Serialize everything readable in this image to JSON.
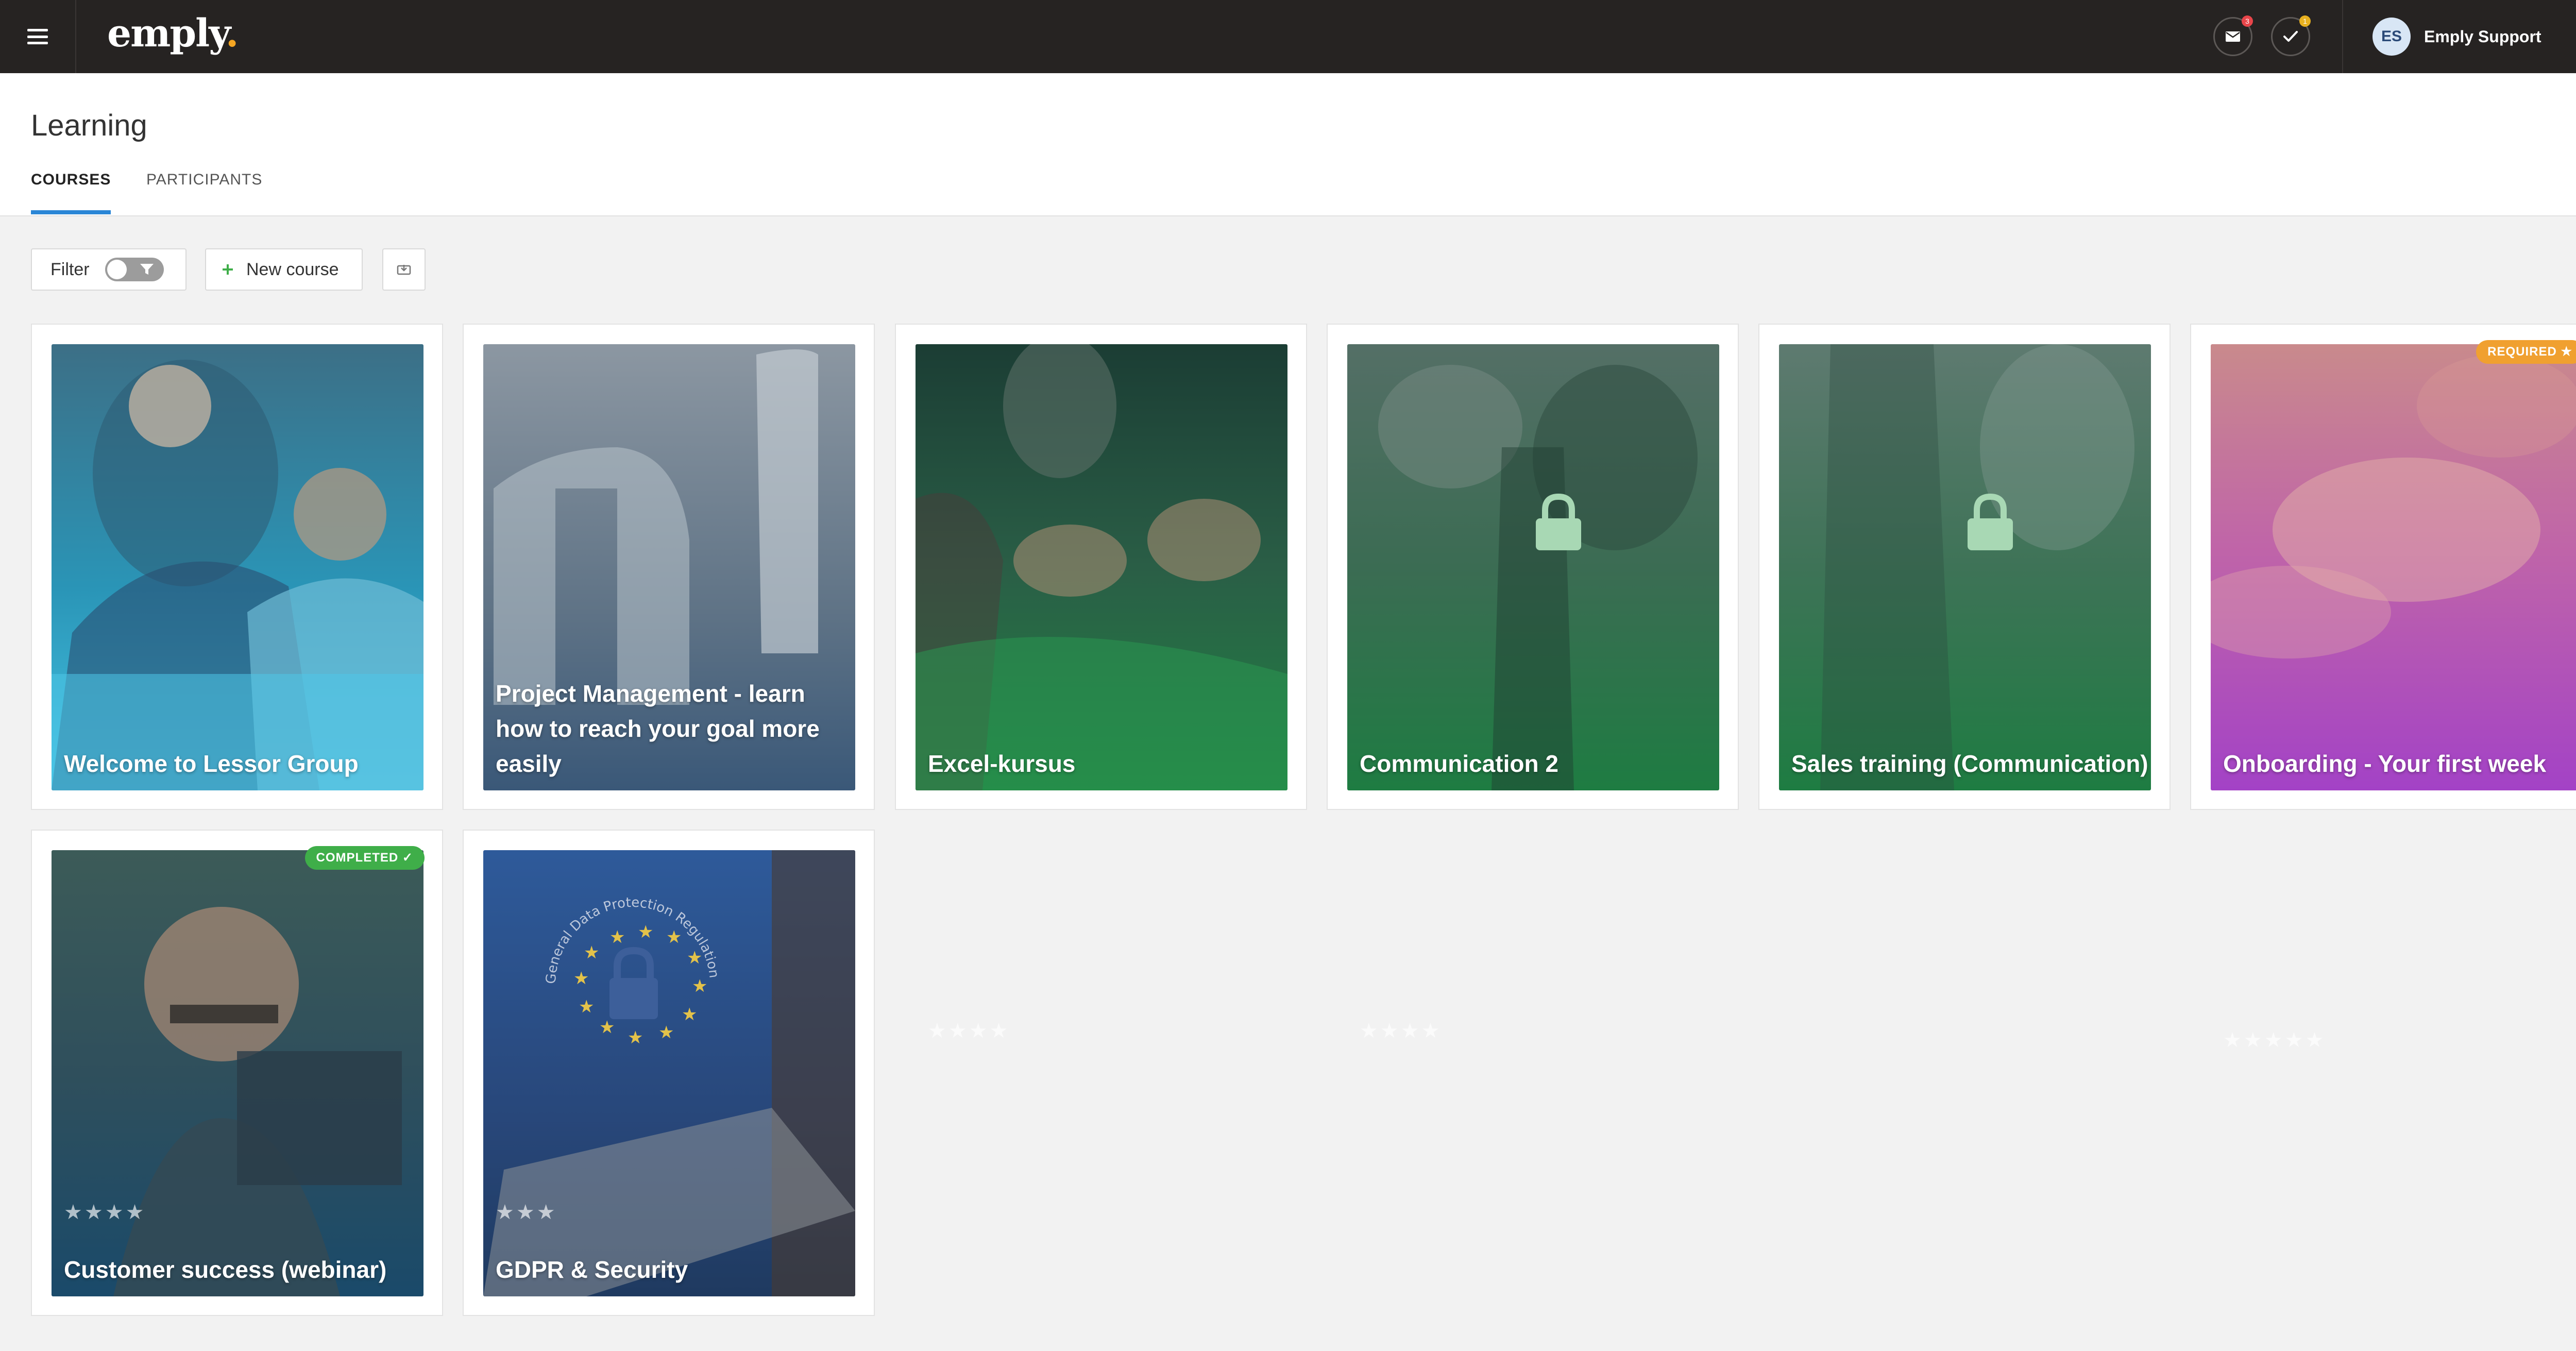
{
  "topbar": {
    "logo_text": "emply",
    "logo_dot": ".",
    "messages_badge": "3",
    "tasks_badge": "1",
    "user_initials": "ES",
    "user_name": "Emply Support"
  },
  "page": {
    "title": "Learning",
    "tabs": [
      {
        "label": "COURSES",
        "active": true
      },
      {
        "label": "PARTICIPANTS",
        "active": false
      }
    ]
  },
  "toolbar": {
    "filter_label": "Filter",
    "new_course_label": "New course"
  },
  "courses": [
    {
      "title": "Welcome to Lessor Group",
      "stars": "",
      "badge": "",
      "locked": false
    },
    {
      "title": "Project Management - learn how to reach your goal more easily",
      "stars": "",
      "badge": "",
      "locked": false
    },
    {
      "title": "Excel-kursus",
      "stars": "★★★★",
      "badge": "",
      "locked": false
    },
    {
      "title": "Communication 2",
      "stars": "★★★★",
      "badge": "",
      "locked": true
    },
    {
      "title": "Sales training (Communication)",
      "stars": "",
      "badge": "",
      "locked": true
    },
    {
      "title": "Onboarding - Your first week",
      "stars": "★★★★★",
      "badge": "REQUIRED ★",
      "locked": false
    },
    {
      "title": "Customer success (webinar)",
      "stars": "★★★★",
      "badge": "COMPLETED ✓",
      "locked": false
    },
    {
      "title": "GDPR & Security",
      "stars": "★★★",
      "badge": "",
      "locked": false
    }
  ],
  "gdpr_seal_text": "General Data Protection Regulation (GDPR)",
  "colors": {
    "topbar": "#262322",
    "accent_tab": "#2a86d6",
    "logo_dot": "#f5a623",
    "required_badge": "#f0a030",
    "completed_badge": "#3fae49",
    "new_course_plus": "#3fae49"
  }
}
